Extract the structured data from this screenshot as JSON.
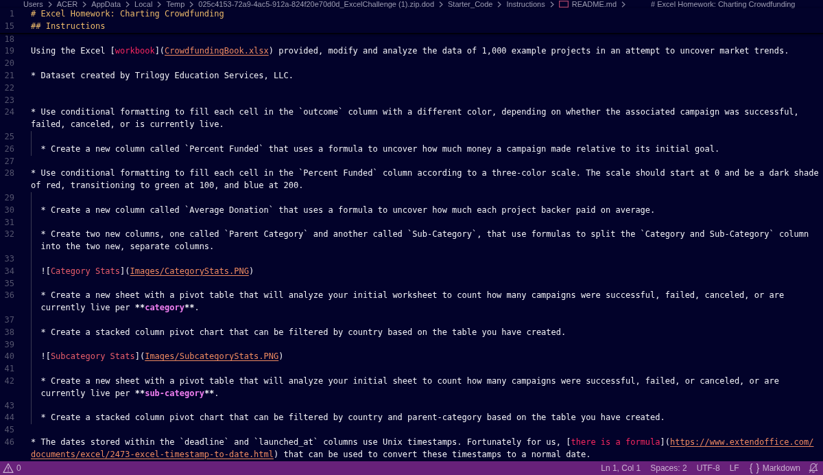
{
  "breadcrumb": {
    "items": [
      {
        "kind": "folder",
        "label": "Users"
      },
      {
        "kind": "folder",
        "label": "ACER"
      },
      {
        "kind": "folder",
        "label": "AppData"
      },
      {
        "kind": "folder",
        "label": "Local"
      },
      {
        "kind": "folder",
        "label": "Temp"
      },
      {
        "kind": "folder",
        "label": "025c4153-72a9-4ac5-912a-824f20e70d0d_ExcelChallenge (1).zip.dod"
      },
      {
        "kind": "folder",
        "label": "Starter_Code"
      },
      {
        "kind": "folder",
        "label": "Instructions"
      },
      {
        "kind": "file",
        "label": "README.md"
      },
      {
        "kind": "symbol",
        "label": "# Excel Homework: Charting Crowdfunding"
      }
    ]
  },
  "editor": {
    "sticky_lines": [
      {
        "number": "1",
        "segments": [
          {
            "kind": "heading",
            "text": "# Excel Homework: Charting Crowdfunding"
          }
        ]
      },
      {
        "number": "15",
        "segments": [
          {
            "kind": "heading",
            "text": "## Instructions"
          }
        ]
      }
    ],
    "lines": [
      {
        "number": "18"
      },
      {
        "number": "19",
        "segments": [
          {
            "kind": "plain",
            "text": "Using the Excel ["
          },
          {
            "kind": "link_text",
            "text": "workbook"
          },
          {
            "kind": "plain",
            "text": "]("
          },
          {
            "kind": "link_url",
            "text": "CrowdfundingBook.xlsx"
          },
          {
            "kind": "plain",
            "text": ") provided, modify and analyze the data of 1,000 example projects in an attempt to uncover market trends."
          }
        ]
      },
      {
        "number": "20"
      },
      {
        "number": "21",
        "segments": [
          {
            "kind": "plain",
            "text": "* Dataset created by Trilogy Education Services, LLC."
          }
        ]
      },
      {
        "number": "22"
      },
      {
        "number": "23"
      },
      {
        "number": "24",
        "segments": [
          {
            "kind": "plain",
            "text": "* Use conditional formatting to fill each cell in the `outcome` column with a different color, depending on whether the associated campaign was successful, failed, canceled, or is currently live."
          }
        ],
        "children": [
          {
            "number": "25"
          },
          {
            "number": "26",
            "segments": [
              {
                "kind": "plain",
                "text": "* Create a new column called `Percent Funded` that uses a formula to uncover how much money a campaign made relative to its initial goal."
              }
            ]
          }
        ]
      },
      {
        "number": "27"
      },
      {
        "number": "28",
        "segments": [
          {
            "kind": "plain",
            "text": "* Use conditional formatting to fill each cell in the `Percent Funded` column according to a three-color scale. The scale should start at 0 and be a dark shade of red, transitioning to green at 100, and blue at 200."
          }
        ],
        "children": [
          {
            "number": "29"
          },
          {
            "number": "30",
            "segments": [
              {
                "kind": "plain",
                "text": "* Create a new column called `Average Donation` that uses a formula to uncover how much each project backer paid on average."
              }
            ]
          },
          {
            "number": "31"
          },
          {
            "number": "32",
            "segments": [
              {
                "kind": "plain",
                "text": "* Create two new columns, one called `Parent Category` and another called `Sub-Category`, that use formulas to split the `Category and Sub-Category` column into the two new, separate columns."
              }
            ]
          },
          {
            "number": "33"
          },
          {
            "number": "34",
            "segments": [
              {
                "kind": "plain",
                "text": "!["
              },
              {
                "kind": "image_alt",
                "text": "Category Stats"
              },
              {
                "kind": "plain",
                "text": "]("
              },
              {
                "kind": "link_url",
                "text": "Images/CategoryStats.PNG"
              },
              {
                "kind": "plain",
                "text": ")"
              }
            ]
          },
          {
            "number": "35"
          },
          {
            "number": "36",
            "segments": [
              {
                "kind": "plain",
                "text": "* Create a new sheet with a pivot table that will analyze your initial worksheet to count how many campaigns were successful, failed, canceled, or are currently live per "
              },
              {
                "kind": "bold_marker",
                "text": "**"
              },
              {
                "kind": "bold",
                "text": "category"
              },
              {
                "kind": "bold_marker",
                "text": "**"
              },
              {
                "kind": "plain",
                "text": "."
              }
            ]
          },
          {
            "number": "37"
          },
          {
            "number": "38",
            "segments": [
              {
                "kind": "plain",
                "text": "* Create a stacked column pivot chart that can be filtered by country based on the table you have created."
              }
            ]
          },
          {
            "number": "39"
          },
          {
            "number": "40",
            "segments": [
              {
                "kind": "plain",
                "text": "!["
              },
              {
                "kind": "image_alt",
                "text": "Subcategory Stats"
              },
              {
                "kind": "plain",
                "text": "]("
              },
              {
                "kind": "link_url",
                "text": "Images/SubcategoryStats.PNG"
              },
              {
                "kind": "plain",
                "text": ")"
              }
            ]
          },
          {
            "number": "41"
          },
          {
            "number": "42",
            "segments": [
              {
                "kind": "plain",
                "text": "* Create a new sheet with a pivot table that will analyze your initial sheet to count how many campaigns were successful, failed, or canceled, or are currently live per "
              },
              {
                "kind": "bold_marker",
                "text": "**"
              },
              {
                "kind": "bold",
                "text": "sub-category"
              },
              {
                "kind": "bold_marker",
                "text": "**"
              },
              {
                "kind": "plain",
                "text": "."
              }
            ]
          },
          {
            "number": "43"
          },
          {
            "number": "44",
            "segments": [
              {
                "kind": "plain",
                "text": "* Create a stacked column pivot chart that can be filtered by country and parent-category based on the table you have created."
              }
            ]
          }
        ]
      },
      {
        "number": "45"
      },
      {
        "number": "46",
        "segments": [
          {
            "kind": "plain",
            "text": "* The dates stored within the `deadline` and `launched_at` columns use Unix timestamps. Fortunately for us, ["
          },
          {
            "kind": "link_text",
            "text": "there is a formula"
          },
          {
            "kind": "plain",
            "text": "]("
          },
          {
            "kind": "link_url",
            "text": "https://www.extendoffice.com/"
          },
          {
            "kind": "link_url",
            "text": "documents/excel/2473-excel-timestamp-to-date.html"
          },
          {
            "kind": "plain",
            "text": ") that can be used to convert these timestamps to a normal date."
          }
        ]
      }
    ]
  },
  "status_bar": {
    "problems": "0",
    "items": [
      {
        "kind": "text",
        "label": "Ln 1, Col 1"
      },
      {
        "kind": "text",
        "label": "Spaces: 2"
      },
      {
        "kind": "text",
        "label": "UTF-8"
      },
      {
        "kind": "text",
        "label": "LF"
      },
      {
        "kind": "language",
        "label": "Markdown"
      }
    ]
  }
}
